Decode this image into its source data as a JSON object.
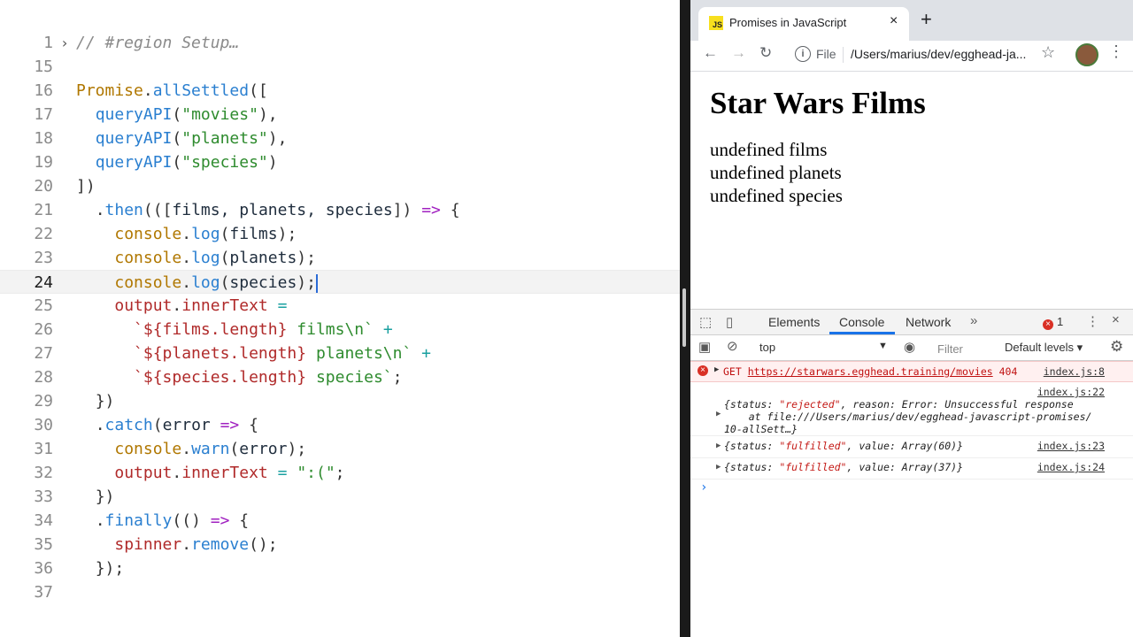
{
  "editor": {
    "lines": [
      {
        "num": "1",
        "code": "<span class=\"t-com\">// #region Setup…</span>"
      },
      {
        "num": "15",
        "code": ""
      },
      {
        "num": "16",
        "code": "<span class=\"t-fn\">Promise</span><span class=\"t-punc\">.</span><span class=\"t-call\">allSettled</span><span class=\"t-punc\">([</span>"
      },
      {
        "num": "17",
        "code": "  <span class=\"t-call\">queryAPI</span><span class=\"t-punc\">(</span><span class=\"t-str\">\"movies\"</span><span class=\"t-punc\">),</span>"
      },
      {
        "num": "18",
        "code": "  <span class=\"t-call\">queryAPI</span><span class=\"t-punc\">(</span><span class=\"t-str\">\"planets\"</span><span class=\"t-punc\">),</span>"
      },
      {
        "num": "19",
        "code": "  <span class=\"t-call\">queryAPI</span><span class=\"t-punc\">(</span><span class=\"t-str\">\"species\"</span><span class=\"t-punc\">)</span>"
      },
      {
        "num": "20",
        "code": "<span class=\"t-punc\">])</span>"
      },
      {
        "num": "21",
        "code": "  <span class=\"t-punc\">.</span><span class=\"t-call\">then</span><span class=\"t-punc\">(([</span><span class=\"t-plain\">films, planets, species</span><span class=\"t-punc\">])</span> <span class=\"t-kw\">=&gt;</span> <span class=\"t-punc\">{</span>"
      },
      {
        "num": "22",
        "code": "    <span class=\"t-fn\">console</span><span class=\"t-punc\">.</span><span class=\"t-call\">log</span><span class=\"t-punc\">(</span><span class=\"t-plain\">films</span><span class=\"t-punc\">);</span>"
      },
      {
        "num": "23",
        "code": "    <span class=\"t-fn\">console</span><span class=\"t-punc\">.</span><span class=\"t-call\">log</span><span class=\"t-punc\">(</span><span class=\"t-plain\">planets</span><span class=\"t-punc\">);</span>"
      },
      {
        "num": "24",
        "code": "    <span class=\"t-fn\">console</span><span class=\"t-punc\">.</span><span class=\"t-call\">log</span><span class=\"t-punc\">(</span><span class=\"t-plain\">species</span><span class=\"t-punc\">);</span><span class=\"cursor\"></span>",
        "current": true
      },
      {
        "num": "25",
        "code": "    <span class=\"t-prop\">output</span><span class=\"t-punc\">.</span><span class=\"t-prop\">innerText</span> <span class=\"t-tmpl\">=</span>"
      },
      {
        "num": "26",
        "code": "      <span class=\"t-prop\">`${films.length}</span> <span class=\"t-str\">films\\n`</span> <span class=\"t-tmpl\">+</span>"
      },
      {
        "num": "27",
        "code": "      <span class=\"t-prop\">`${planets.length}</span> <span class=\"t-str\">planets\\n`</span> <span class=\"t-tmpl\">+</span>"
      },
      {
        "num": "28",
        "code": "      <span class=\"t-prop\">`${species.length}</span> <span class=\"t-str\">species`</span><span class=\"t-punc\">;</span>"
      },
      {
        "num": "29",
        "code": "  <span class=\"t-punc\">})</span>"
      },
      {
        "num": "30",
        "code": "  <span class=\"t-punc\">.</span><span class=\"t-call\">catch</span><span class=\"t-punc\">(</span><span class=\"t-plain\">error</span> <span class=\"t-kw\">=&gt;</span> <span class=\"t-punc\">{</span>"
      },
      {
        "num": "31",
        "code": "    <span class=\"t-fn\">console</span><span class=\"t-punc\">.</span><span class=\"t-call\">warn</span><span class=\"t-punc\">(</span><span class=\"t-plain\">error</span><span class=\"t-punc\">);</span>"
      },
      {
        "num": "32",
        "code": "    <span class=\"t-prop\">output</span><span class=\"t-punc\">.</span><span class=\"t-prop\">innerText</span> <span class=\"t-tmpl\">=</span> <span class=\"t-str\">\":(\"</span><span class=\"t-punc\">;</span>"
      },
      {
        "num": "33",
        "code": "  <span class=\"t-punc\">})</span>"
      },
      {
        "num": "34",
        "code": "  <span class=\"t-punc\">.</span><span class=\"t-call\">finally</span><span class=\"t-punc\">(()</span> <span class=\"t-kw\">=&gt;</span> <span class=\"t-punc\">{</span>"
      },
      {
        "num": "35",
        "code": "    <span class=\"t-prop\">spinner</span><span class=\"t-punc\">.</span><span class=\"t-call\">remove</span><span class=\"t-punc\">();</span>"
      },
      {
        "num": "36",
        "code": "  <span class=\"t-punc\">});</span>"
      },
      {
        "num": "37",
        "code": ""
      }
    ]
  },
  "browser": {
    "tab_title": "Promises in JavaScript",
    "tab_favicon": "JS",
    "omni_scheme": "File",
    "omni_url": "/Users/marius/dev/egghead-ja..."
  },
  "page": {
    "title": "Star Wars Films",
    "lines": [
      "undefined films",
      "undefined planets",
      "undefined species"
    ]
  },
  "devtools": {
    "tabs": [
      "Elements",
      "Console",
      "Network"
    ],
    "error_count": "1",
    "context": "top",
    "filter_placeholder": "Filter",
    "levels": "Default levels",
    "error_method": "GET",
    "error_url": "https://starwars.egghead.training/movies",
    "error_status": "404",
    "error_src": "index.js:8",
    "msg1_src": "index.js:22",
    "msg1_line1_a": "{status: ",
    "msg1_line1_b": "\"rejected\"",
    "msg1_line1_c": ", reason: Error: Unsuccessful response",
    "msg1_line2": "    at file:///Users/marius/dev/egghead-javascript-promises/",
    "msg1_line3": "10-allSett…}",
    "msg2_src": "index.js:23",
    "msg2_a": "{status: ",
    "msg2_b": "\"fulfilled\"",
    "msg2_c": ", value: Array(60)}",
    "msg3_src": "index.js:24",
    "msg3_a": "{status: ",
    "msg3_b": "\"fulfilled\"",
    "msg3_c": ", value: Array(37)}",
    "prompt": "›"
  },
  "icons": {
    "close": "×",
    "newtab": "+",
    "back": "←",
    "forward": "→",
    "reload": "↻",
    "star": "☆",
    "more": "⋮",
    "overflow": "»",
    "fold": "›"
  }
}
